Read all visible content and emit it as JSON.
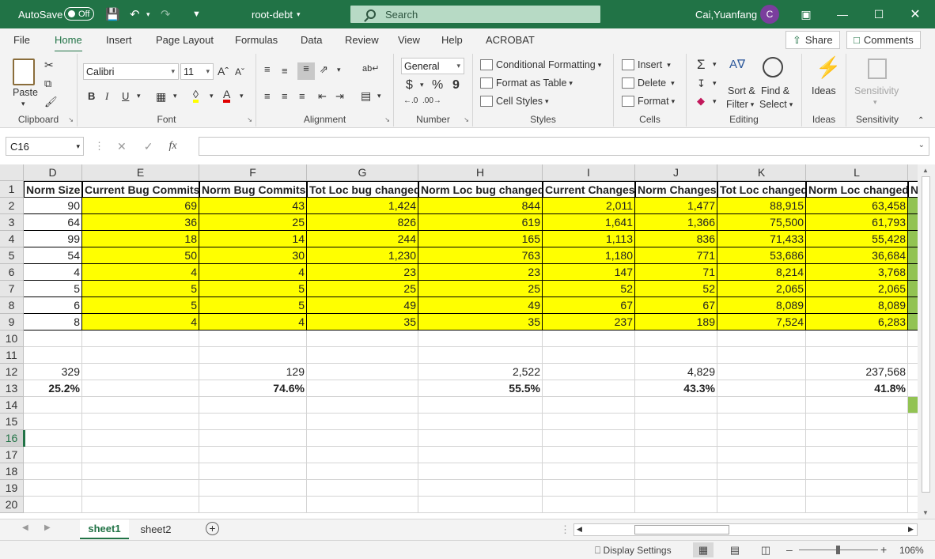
{
  "titlebar": {
    "autosave_label": "AutoSave",
    "autosave_state": "Off",
    "doc_title": "root-debt",
    "search_placeholder": "Search",
    "user_name": "Cai,Yuanfang",
    "avatar_initial": "C"
  },
  "menu": {
    "tabs": [
      "File",
      "Home",
      "Insert",
      "Page Layout",
      "Formulas",
      "Data",
      "Review",
      "View",
      "Help",
      "ACROBAT"
    ],
    "share_label": "Share",
    "comments_label": "Comments"
  },
  "ribbon": {
    "clipboard": {
      "paste": "Paste",
      "label": "Clipboard"
    },
    "font": {
      "name": "Calibri",
      "size": "11",
      "bold": "B",
      "italic": "I",
      "underline": "U",
      "label": "Font"
    },
    "alignment": {
      "label": "Alignment"
    },
    "number": {
      "format": "General",
      "currency": "$",
      "percent": "%",
      "comma": "9",
      "label": "Number"
    },
    "styles": {
      "conditional": "Conditional Formatting",
      "format_table": "Format as Table",
      "cell_styles": "Cell Styles",
      "label": "Styles"
    },
    "cells": {
      "insert": "Insert",
      "delete": "Delete",
      "format": "Format",
      "label": "Cells"
    },
    "editing": {
      "sort": "Sort &",
      "filter": "Filter",
      "find": "Find &",
      "select": "Select",
      "label": "Editing"
    },
    "ideas": {
      "button": "Ideas",
      "label": "Ideas"
    },
    "sensitivity": {
      "button": "Sensitivity",
      "label": "Sensitivity"
    }
  },
  "formula_bar": {
    "name_box": "C16",
    "fx": "fx",
    "formula": ""
  },
  "grid": {
    "columns": [
      "D",
      "E",
      "F",
      "G",
      "H",
      "I",
      "J",
      "K",
      "L"
    ],
    "rows": [
      "1",
      "2",
      "3",
      "4",
      "5",
      "6",
      "7",
      "8",
      "9",
      "10",
      "11",
      "12",
      "13",
      "14",
      "15",
      "16",
      "17",
      "18",
      "19",
      "20"
    ],
    "headers": [
      "Norm Size",
      "Current Bug Commits",
      "Norm Bug Commits",
      "Tot Loc bug changed",
      "Norm Loc bug changed",
      "Current Changes",
      "Norm Changes",
      "Tot Loc changed",
      "Norm Loc changed",
      "N"
    ],
    "data": [
      [
        "90",
        "69",
        "43",
        "1,424",
        "844",
        "2,011",
        "1,477",
        "88,915",
        "63,458"
      ],
      [
        "64",
        "36",
        "25",
        "826",
        "619",
        "1,641",
        "1,366",
        "75,500",
        "61,793"
      ],
      [
        "99",
        "18",
        "14",
        "244",
        "165",
        "1,113",
        "836",
        "71,433",
        "55,428"
      ],
      [
        "54",
        "50",
        "30",
        "1,230",
        "763",
        "1,180",
        "771",
        "53,686",
        "36,684"
      ],
      [
        "4",
        "4",
        "4",
        "23",
        "23",
        "147",
        "71",
        "8,214",
        "3,768"
      ],
      [
        "5",
        "5",
        "5",
        "25",
        "25",
        "52",
        "52",
        "2,065",
        "2,065"
      ],
      [
        "6",
        "5",
        "5",
        "49",
        "49",
        "67",
        "67",
        "8,089",
        "8,089"
      ],
      [
        "8",
        "4",
        "4",
        "35",
        "35",
        "237",
        "189",
        "7,524",
        "6,283"
      ]
    ],
    "totals": [
      "329",
      "",
      "129",
      "",
      "2,522",
      "",
      "4,829",
      "",
      "237,568"
    ],
    "percents": [
      "25.2%",
      "",
      "74.6%",
      "",
      "55.5%",
      "",
      "43.3%",
      "",
      "41.8%"
    ]
  },
  "sheets": {
    "tabs": [
      "sheet1",
      "sheet2"
    ],
    "active": "sheet1"
  },
  "status": {
    "display_settings": "Display Settings",
    "zoom": "106%"
  },
  "colors": {
    "accent": "#217346",
    "highlight": "#ffff00",
    "green_cell": "#92c353"
  }
}
